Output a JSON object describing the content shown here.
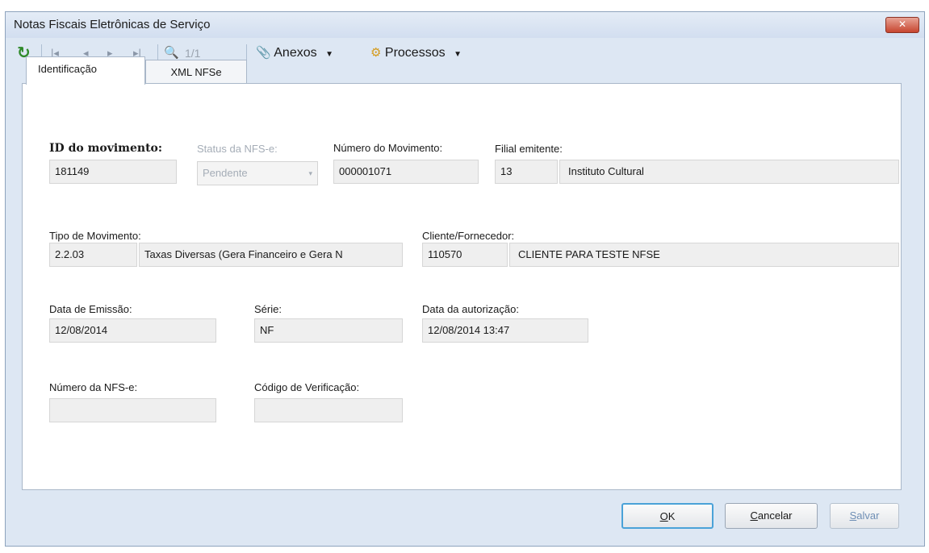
{
  "window": {
    "title": "Notas Fiscais Eletrônicas de Serviço",
    "close_glyph": "✕"
  },
  "toolbar": {
    "refresh_icon": "↻",
    "first_icon": "|◂",
    "prev_icon": "◂",
    "next_icon": "▸",
    "last_icon": "▸|",
    "search_icon": "🔍",
    "record_counter": "1/1",
    "attachments_label": "Anexos",
    "processes_label": "Processos",
    "dropdown_glyph": "▼"
  },
  "tabs": [
    {
      "label": "Identificação",
      "active": true
    },
    {
      "label": "XML NFSe",
      "active": false
    }
  ],
  "form": {
    "id_movimento": {
      "label": "ID do movimento:",
      "value": "181149"
    },
    "status_nfse": {
      "label": "Status da NFS-e:",
      "value": "Pendente",
      "arrow": "▾"
    },
    "numero_movimento": {
      "label": "Número do Movimento:",
      "value": "000001071"
    },
    "filial_emitente": {
      "label": "Filial emitente:",
      "code": "13",
      "name": "Instituto Cultural"
    },
    "tipo_movimento": {
      "label": "Tipo de Movimento:",
      "code": "2.2.03",
      "name": "Taxas Diversas (Gera Financeiro e Gera N"
    },
    "cliente_fornecedor": {
      "label": "Cliente/Fornecedor:",
      "code": "110570",
      "name": "CLIENTE PARA TESTE NFSE"
    },
    "data_emissao": {
      "label": "Data de Emissão:",
      "value": "12/08/2014"
    },
    "serie": {
      "label": "Série:",
      "value": "NF"
    },
    "data_autorizacao": {
      "label": "Data da autorização:",
      "value": "12/08/2014 13:47"
    },
    "numero_nfse": {
      "label": "Número da NFS-e:",
      "value": ""
    },
    "codigo_verificacao": {
      "label": "Código de Verificação:",
      "value": ""
    }
  },
  "buttons": {
    "ok": {
      "mnemonic": "O",
      "rest": "K"
    },
    "cancel": {
      "mnemonic": "C",
      "rest": "ancelar"
    },
    "save": {
      "mnemonic": "S",
      "rest": "alvar"
    }
  },
  "colors": {
    "accent": "#4aa2d8",
    "window_bg": "#dde7f3",
    "field_bg": "#efefef"
  }
}
